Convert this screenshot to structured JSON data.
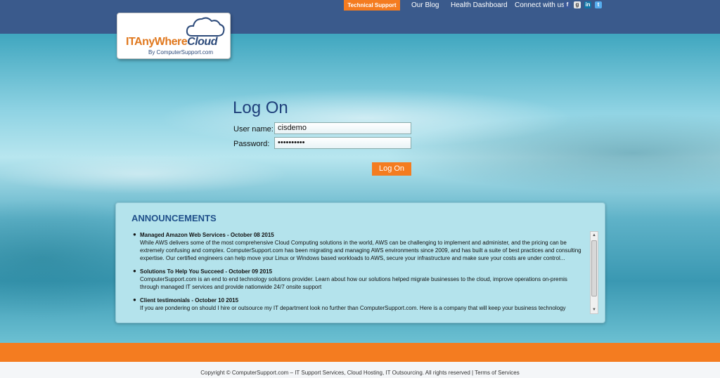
{
  "header": {
    "tech_support": "Technical Support",
    "our_blog": "Our Blog",
    "health_dashboard": "Health Dashboard",
    "connect_with_us": "Connect with us",
    "social_icons": [
      "facebook-icon",
      "google-icon",
      "linkedin-icon",
      "twitter-icon"
    ]
  },
  "logo": {
    "name_part1": "ITAnyWhere",
    "name_part2": "Cloud",
    "subtitle": "By ComputerSupport.com"
  },
  "login": {
    "title": "Log On",
    "username_label": "User name:",
    "username_value": "cisdemo",
    "password_label": "Password:",
    "password_value": "••••••••••",
    "button": "Log On"
  },
  "announcements": {
    "title": "ANNOUNCEMENTS",
    "items": [
      {
        "title": "Managed Amazon Web Services - October 08 2015",
        "body": "While AWS delivers some of the most comprehensive Cloud Computing solutions in the world, AWS can be challenging to implement and administer, and the pricing can be extremely confusing and complex. ComputerSupport.com has been migrating and managing AWS environments since 2009, and has built a suite of best practices and consulting expertise. Our certified engineers can help move your Linux or Windows based workloads to AWS, secure your infrastructure and make sure your costs are under control..."
      },
      {
        "title": "Solutions To Help You Succeed - October 09 2015",
        "body": "ComputerSupport.com is an end to end technology solutions provider. Learn about how our solutions helped migrate businesses to the cloud, improve operations on-premis through managed IT services and provide nationwide 24/7 onsite support"
      },
      {
        "title": "Client testimonials - October 10 2015",
        "body": "If you are pondering on should I hire or outsource my IT department look no further than ComputerSupport.com. Here is a company that will keep your business technology"
      }
    ]
  },
  "footer": {
    "text": "Copyright © ComputerSupport.com – IT Support Services, Cloud Hosting, IT Outsourcing. All rights reserved | Terms of Services"
  },
  "colors": {
    "accent": "#f47c20",
    "header_bg": "#3a5a8c",
    "title_blue": "#1e3f7a"
  }
}
